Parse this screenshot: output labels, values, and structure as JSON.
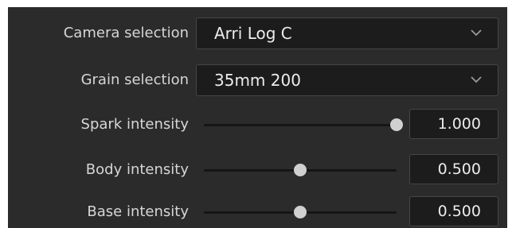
{
  "camera_selection": {
    "label": "Camera selection",
    "value": "Arri Log C"
  },
  "grain_selection": {
    "label": "Grain selection",
    "value": "35mm 200"
  },
  "spark_intensity": {
    "label": "Spark intensity",
    "value": "1.000",
    "level": 1.0
  },
  "body_intensity": {
    "label": "Body intensity",
    "value": "0.500",
    "level": 0.5
  },
  "base_intensity": {
    "label": "Base intensity",
    "value": "0.500",
    "level": 0.5
  },
  "colors": {
    "panel_bg": "#2b2b2b",
    "field_bg": "#1c1c1c",
    "text": "#d6d6d6",
    "handle": "#d0d0d0"
  },
  "icons": {
    "dropdown": "chevron-down-icon",
    "slider_handle": "circle"
  }
}
